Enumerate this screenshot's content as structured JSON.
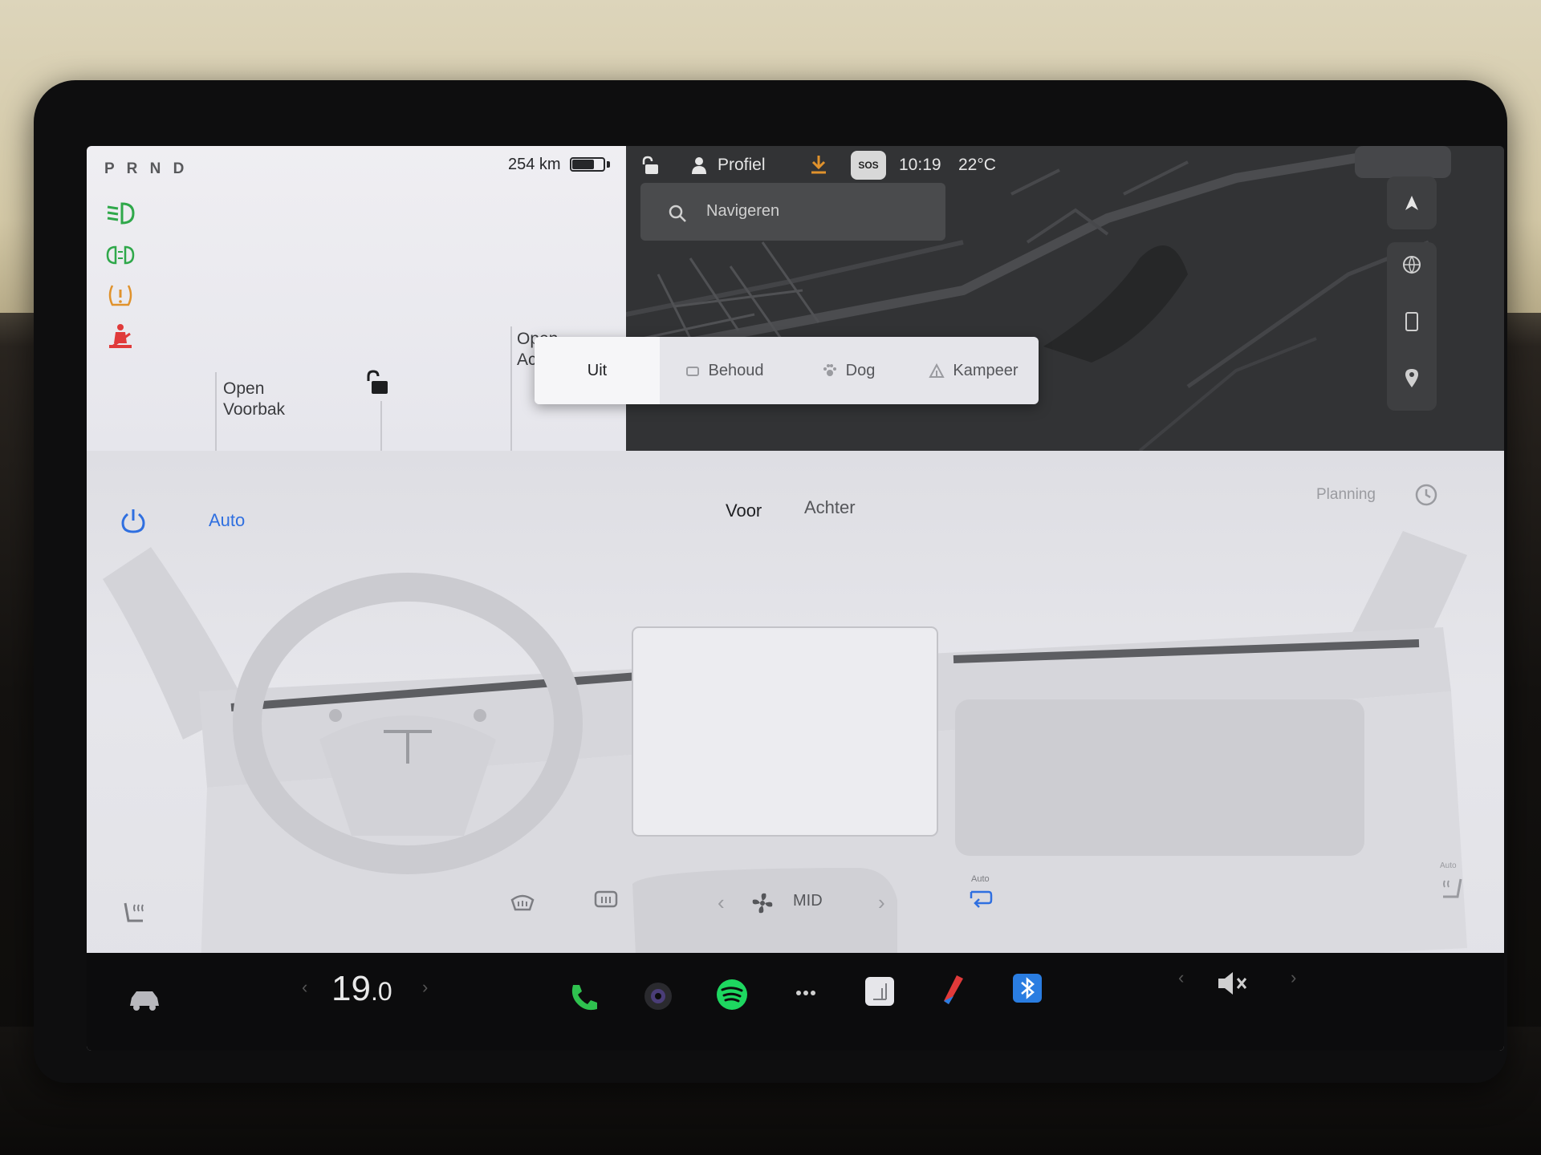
{
  "status": {
    "gear": "P R N D",
    "range": "254 km",
    "battery_level": 0.7,
    "profile_label": "Profiel",
    "sos": "SOS",
    "time": "10:19",
    "outside_temp": "22°C"
  },
  "car_panel": {
    "frunk_label_1": "Open",
    "frunk_label_2": "Voorbak",
    "trunk_label_1": "Open",
    "trunk_label_2": "Ac"
  },
  "map": {
    "search_placeholder": "Navigeren"
  },
  "climate_keeper": {
    "options": [
      "Uit",
      "Behoud",
      "Dog",
      "Kampeer"
    ],
    "selected": "Uit"
  },
  "climate": {
    "auto_label": "Auto",
    "front_tab": "Voor",
    "rear_tab": "Achter",
    "schedule_label": "Planning",
    "fan_level": "MID",
    "recirc_label": "Auto",
    "seat_auto_label": "Auto"
  },
  "dock": {
    "driver_temp_main": "19",
    "driver_temp_decimal": ".0"
  },
  "colors": {
    "accent_blue": "#2f6fe0",
    "headlight_green": "#2fa84a",
    "warning_orange": "#e0922c",
    "seatbelt_red": "#e03a3a",
    "phone_green": "#2fc24f",
    "spotify_green": "#1ed760",
    "bluetooth_blue": "#2a7de1"
  }
}
